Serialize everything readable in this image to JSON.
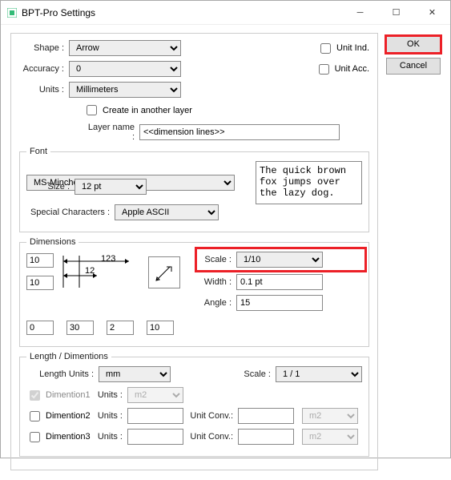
{
  "window": {
    "title": "BPT-Pro Settings"
  },
  "buttons": {
    "ok": "OK",
    "cancel": "Cancel"
  },
  "top": {
    "shape_label": "Shape :",
    "shape_value": "Arrow",
    "accuracy_label": "Accuracy :",
    "accuracy_value": "0",
    "units_label": "Units :",
    "units_value": "Millimeters",
    "unit_ind": "Unit Ind.",
    "unit_acc": "Unit Acc.",
    "create_layer": "Create in another layer",
    "layer_name_label": "Layer name :",
    "layer_name_value": "<<dimension lines>>"
  },
  "font": {
    "legend": "Font",
    "family": "MS-Mincho",
    "size_label": "Size :",
    "size_value": "12 pt",
    "spchar_label": "Special Characters :",
    "spchar_value": "Apple ASCII",
    "preview": "The quick brown fox jumps over the lazy dog."
  },
  "dims": {
    "legend": "Dimensions",
    "v1": "10",
    "v2": "10",
    "d1": "123",
    "d2": "12",
    "b1": "0",
    "b2": "30",
    "b3": "2",
    "b4": "10",
    "scale_label": "Scale :",
    "scale_value": "1/10",
    "width_label": "Width :",
    "width_value": "0.1 pt",
    "angle_label": "Angle :",
    "angle_value": "15"
  },
  "len": {
    "legend": "Length / Dimentions",
    "lu_label": "Length Units :",
    "lu_value": "mm",
    "scale_label": "Scale :",
    "scale_value": "1 / 1",
    "d1": "Dimention1",
    "d2": "Dimention2",
    "d3": "Dimention3",
    "units_label": "Units :",
    "uc_label": "Unit Conv.:",
    "units1": "m2",
    "m2": "m2"
  }
}
